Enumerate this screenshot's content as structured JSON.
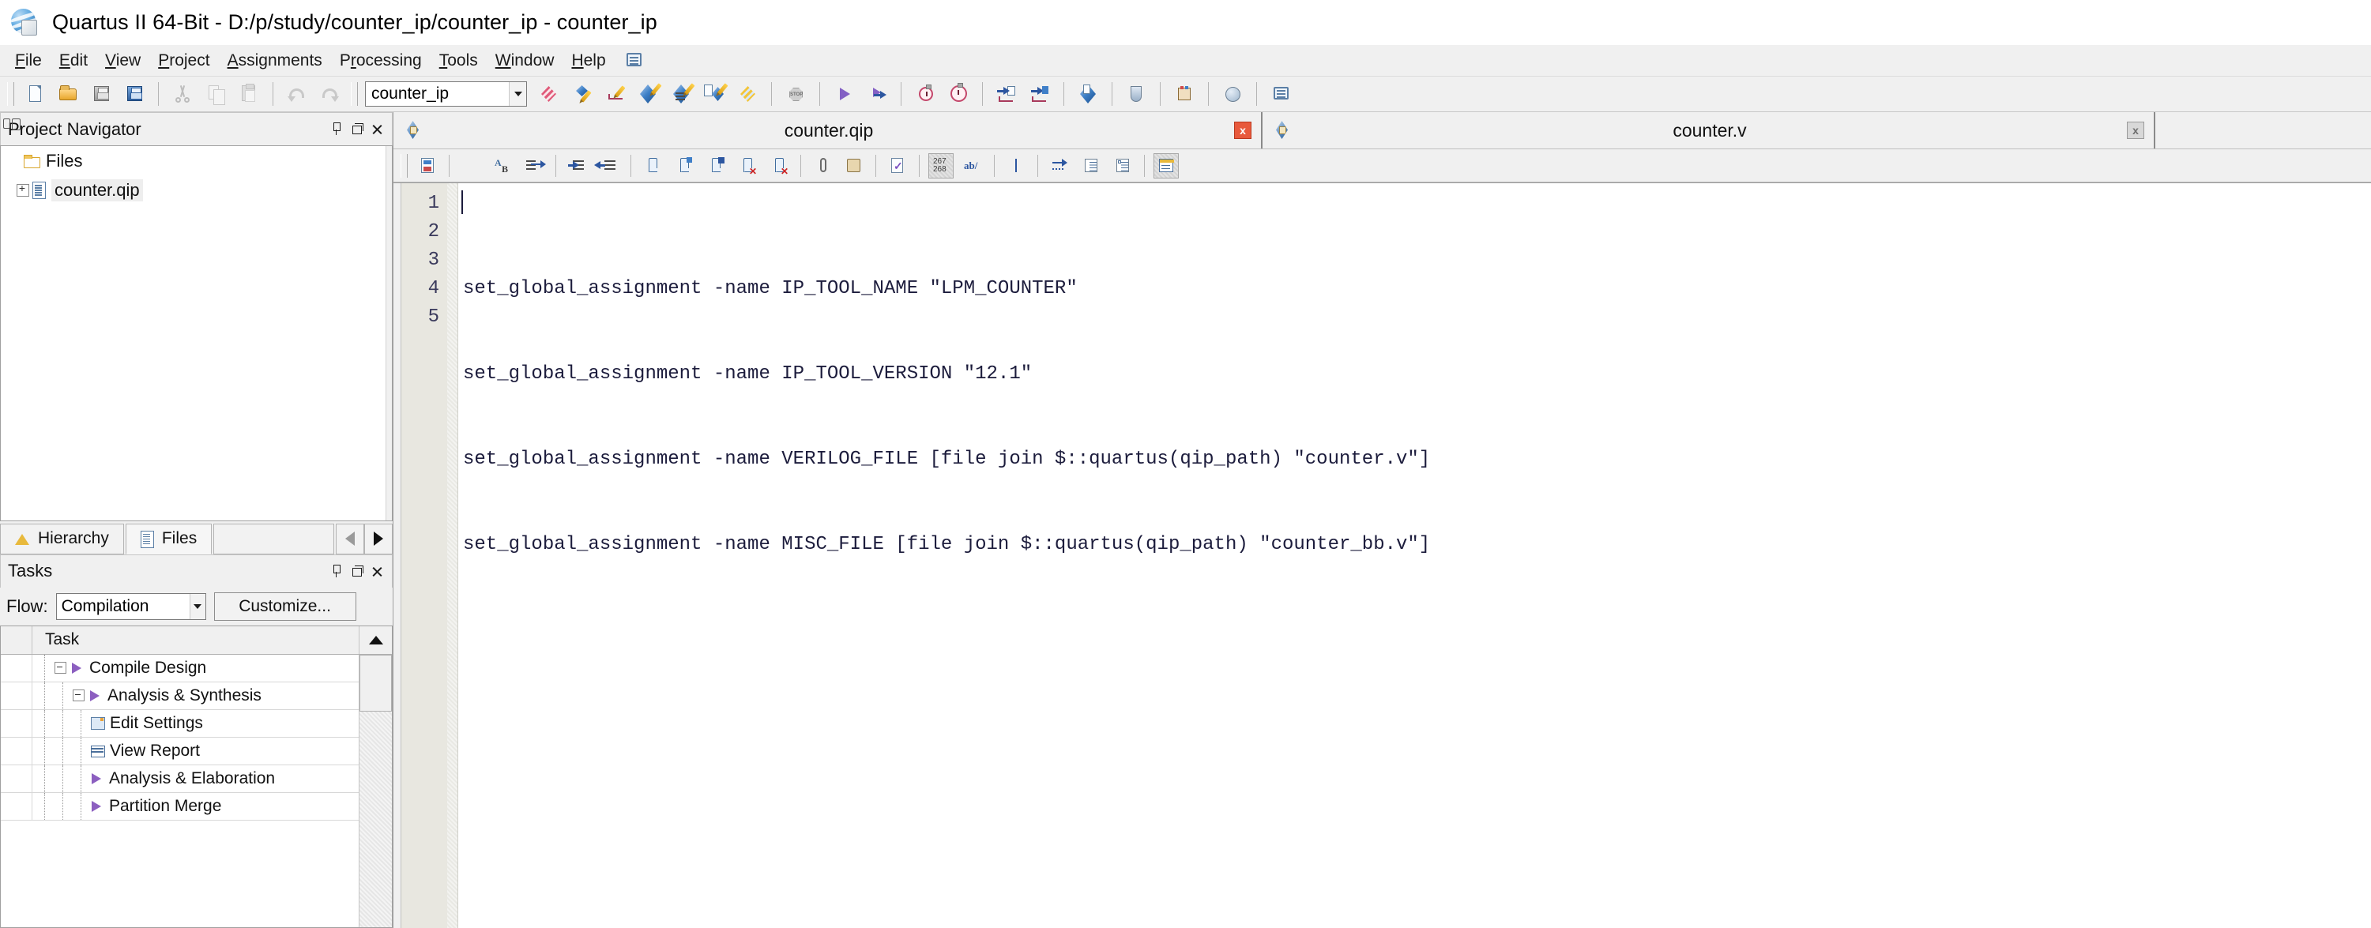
{
  "window": {
    "title": "Quartus II 64-Bit - D:/p/study/counter_ip/counter_ip - counter_ip",
    "app_icon": "quartus-globe-icon"
  },
  "menubar": {
    "items": [
      {
        "label": "File",
        "mnemonic": "F"
      },
      {
        "label": "Edit",
        "mnemonic": "E"
      },
      {
        "label": "View",
        "mnemonic": "V"
      },
      {
        "label": "Project",
        "mnemonic": "P"
      },
      {
        "label": "Assignments",
        "mnemonic": "A"
      },
      {
        "label": "Processing",
        "mnemonic": "r"
      },
      {
        "label": "Tools",
        "mnemonic": "T"
      },
      {
        "label": "Window",
        "mnemonic": "W"
      },
      {
        "label": "Help",
        "mnemonic": "H"
      }
    ],
    "help_icon": "speech-bubble-icon"
  },
  "toolbar": {
    "project_combo_value": "counter_ip",
    "buttons": [
      "new-file-icon",
      "open-file-icon",
      "save-file-icon",
      "save-all-icon",
      "cut-icon",
      "copy-icon",
      "paste-icon",
      "undo-icon",
      "redo-icon",
      "close-project-icon",
      "settings-icon",
      "assignment-editor-icon",
      "compile-icon",
      "compile-design-icon",
      "analysis-synthesis-icon",
      "stop-icon",
      "start-compilation-icon",
      "start-analysis-icon",
      "timing-analyzer-icon",
      "timequest-icon",
      "pin-planner-icon",
      "signal-tap-icon",
      "programmer-icon",
      "chip-planner-icon",
      "megawizard-icon",
      "help-search-icon",
      "help-bubble-icon"
    ]
  },
  "project_navigator": {
    "title": "Project Navigator",
    "panel_buttons": [
      "pin-icon",
      "restore-icon",
      "close-icon"
    ],
    "tree": [
      {
        "label": "Files",
        "icon": "folder-icon",
        "expander": "none",
        "depth": 0,
        "selected": false
      },
      {
        "label": "counter.qip",
        "icon": "file-icon",
        "expander": "plus",
        "depth": 1,
        "selected": true
      }
    ],
    "tabs": [
      {
        "label": "Hierarchy",
        "icon": "hierarchy-icon",
        "active": false
      },
      {
        "label": "Files",
        "icon": "files-icon",
        "active": true
      }
    ],
    "nav_arrows": [
      "prev-tab-arrow",
      "next-tab-arrow"
    ]
  },
  "tasks": {
    "title": "Tasks",
    "panel_buttons": [
      "pin-icon",
      "restore-icon",
      "close-icon"
    ],
    "flow_label": "Flow:",
    "flow_value": "Compilation",
    "customize_label": "Customize...",
    "column_header": "Task",
    "rows": [
      {
        "label": "Compile Design",
        "icon": "run-triangle-icon",
        "expander": "minus",
        "depth": 0
      },
      {
        "label": "Analysis & Synthesis",
        "icon": "run-triangle-icon",
        "expander": "minus",
        "depth": 1
      },
      {
        "label": "Edit Settings",
        "icon": "settings-icon",
        "expander": "none",
        "depth": 2
      },
      {
        "label": "View Report",
        "icon": "report-icon",
        "expander": "none",
        "depth": 2
      },
      {
        "label": "Analysis & Elaboration",
        "icon": "run-triangle-icon",
        "expander": "none",
        "depth": 2
      },
      {
        "label": "Partition Merge",
        "icon": "run-triangle-icon",
        "expander": "none",
        "depth": 2
      }
    ]
  },
  "editor": {
    "tabs": [
      {
        "label": "counter.qip",
        "active": true,
        "icon": "qip-file-icon",
        "close": "x"
      },
      {
        "label": "counter.v",
        "active": false,
        "icon": "verilog-file-icon",
        "close": "x"
      }
    ],
    "edit_toolbar_buttons": [
      "save-in-project-icon",
      "find-icon",
      "find-replace-icon",
      "goto-line-icon",
      "increase-indent-icon",
      "decrease-indent-icon",
      "insert-template-icon",
      "insert-constraint-icon",
      "insert-file-icon",
      "remove-comment-icon",
      "remove-block-icon",
      "paperclip-icon",
      "scroll-icon",
      "check-syntax-icon",
      "line-numbers-icon",
      "word-wrap-icon",
      "show-cursor-icon",
      "show-tabs-icon",
      "indent-view-icon",
      "outline-view-icon",
      "panel-view-icon"
    ],
    "line_numbers_label": "267\n268",
    "word_wrap_label": "ab/",
    "gutter_lines": [
      "1",
      "2",
      "3",
      "4",
      "5"
    ],
    "code_lines": [
      "set_global_assignment -name IP_TOOL_NAME \"LPM_COUNTER\"",
      "set_global_assignment -name IP_TOOL_VERSION \"12.1\"",
      "set_global_assignment -name VERILOG_FILE [file join $::quartus(qip_path) \"counter.v\"]",
      "set_global_assignment -name MISC_FILE [file join $::quartus(qip_path) \"counter_bb.v\"]",
      ""
    ]
  },
  "colors": {
    "window_bg": "#f0f0f0",
    "editor_bg": "#ffffff",
    "gutter_bg": "#e8e7e0",
    "code_text": "#1c1c3c",
    "active_tab_close": "#e8593c",
    "accent_blue": "#2c56a0"
  }
}
